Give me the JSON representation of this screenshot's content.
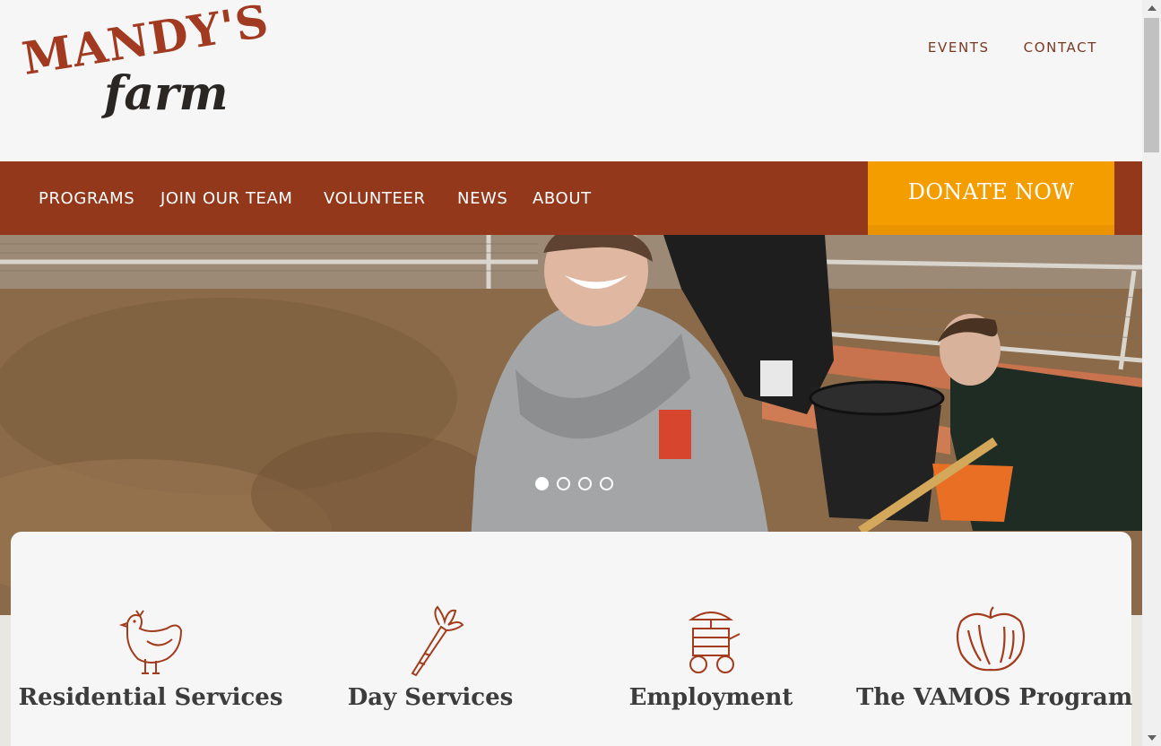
{
  "header": {
    "logo_line1": "MANDY'S",
    "logo_line2": "farm",
    "top_links": [
      "EVENTS",
      "CONTACT"
    ]
  },
  "nav": {
    "items": [
      "PROGRAMS",
      "JOIN OUR TEAM",
      "VOLUNTEER",
      "NEWS",
      "ABOUT"
    ],
    "donate_label": "DONATE NOW"
  },
  "hero": {
    "slide_count": 4,
    "active_slide": 1
  },
  "programs": [
    {
      "title": "Residential Services",
      "icon": "chicken-icon"
    },
    {
      "title": "Day Services",
      "icon": "carrot-icon"
    },
    {
      "title": "Employment",
      "icon": "cart-icon"
    },
    {
      "title": "The VAMOS Program",
      "icon": "apple-icon"
    }
  ],
  "colors": {
    "brand_rust": "#93381b",
    "donate_orange": "#f49d00",
    "logo_rust": "#a13a20"
  }
}
